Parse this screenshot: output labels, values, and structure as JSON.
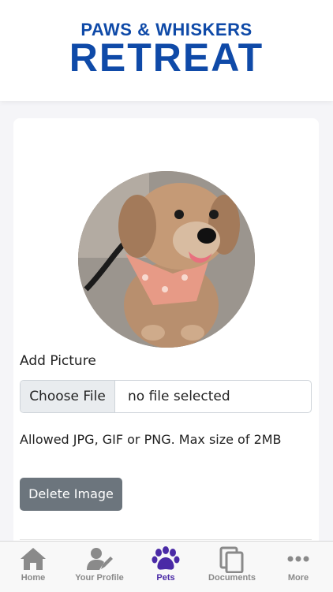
{
  "brand": {
    "line1": "PAWS & WHISKERS",
    "line2": "RETREAT",
    "color": "#0f4aa8"
  },
  "upload": {
    "add_label": "Add Picture",
    "choose_button": "Choose File",
    "file_status": "no file selected",
    "allowed_text": "Allowed JPG, GIF or PNG. Max size of 2MB",
    "delete_button": "Delete Image"
  },
  "tabs": [
    {
      "label": "Home",
      "icon": "home-icon"
    },
    {
      "label": "Your Profile",
      "icon": "profile-edit-icon"
    },
    {
      "label": "Pets",
      "icon": "paw-icon",
      "active": true
    },
    {
      "label": "Documents",
      "icon": "documents-icon"
    },
    {
      "label": "More",
      "icon": "more-icon"
    }
  ],
  "colors": {
    "active_tab": "#4a2aa6",
    "inactive_tab": "#8a8a8a",
    "delete_button": "#6c757d"
  }
}
